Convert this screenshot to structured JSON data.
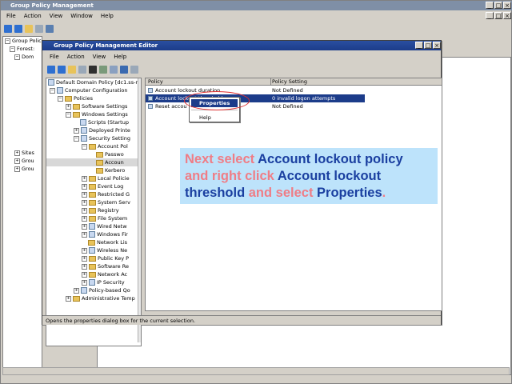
{
  "outer": {
    "title": "Group Policy Management",
    "menu": [
      "File",
      "Action",
      "View",
      "Window",
      "Help"
    ],
    "tree": [
      "Group Polic",
      "Forest:",
      "Dom",
      "Sites",
      "Grou",
      "Grou"
    ]
  },
  "editor": {
    "title": "Group Policy Management Editor",
    "menu": [
      "File",
      "Action",
      "View",
      "Help"
    ],
    "tree": {
      "root": "Default Domain Policy [dc1.ss-n",
      "computer_config": "Computer Configuration",
      "policies": "Policies",
      "software_settings": "Software Settings",
      "windows_settings": "Windows Settings",
      "scripts": "Scripts (Startup",
      "deployed_printers": "Deployed Printe",
      "security_settings": "Security Setting",
      "account_policies": "Account Pol",
      "password": "Passwo",
      "account_lockout": "Accoun",
      "kerberos": "Kerbero",
      "local_policies": "Local Policie",
      "event_log": "Event Log",
      "restricted": "Restricted G",
      "system_services": "System Serv",
      "registry": "Registry",
      "file_system": "File System",
      "wired": "Wired Netw",
      "windows_fw": "Windows Fir",
      "network_list": "Network Lis",
      "wireless": "Wireless Ne",
      "public_key": "Public Key P",
      "software_restriction": "Software Re",
      "network_access": "Network Ac",
      "ip_security": "IP Security",
      "policy_qos": "Policy-based Qo",
      "admin_templates": "Administrative Temp"
    },
    "list": {
      "col_policy": "Policy",
      "col_setting": "Policy Setting",
      "rows": [
        {
          "policy": "Account lockout duration",
          "setting": "Not Defined"
        },
        {
          "policy": "Account lockout threshold",
          "setting": "0 invalid logon attempts"
        },
        {
          "policy": "Reset accou",
          "setting": "Not Defined"
        }
      ]
    },
    "status": "Opens the properties dialog box for the current selection."
  },
  "context_menu": {
    "properties": "Properties",
    "help": "Help"
  },
  "callout": {
    "p1": "Next select ",
    "b1": "Account lockout policy",
    "p2": "and right click ",
    "b2": "Account lockout",
    "b3": "threshold",
    "p3": " and select ",
    "b4": "Properties",
    "p4": "."
  },
  "colors": {
    "callout_bg": "#bde3fb",
    "callout_highlight": "#1a3fa0",
    "callout_plain": "#ef7d86",
    "selection": "#1c3c8a",
    "annotation_ellipse": "#e03030"
  }
}
